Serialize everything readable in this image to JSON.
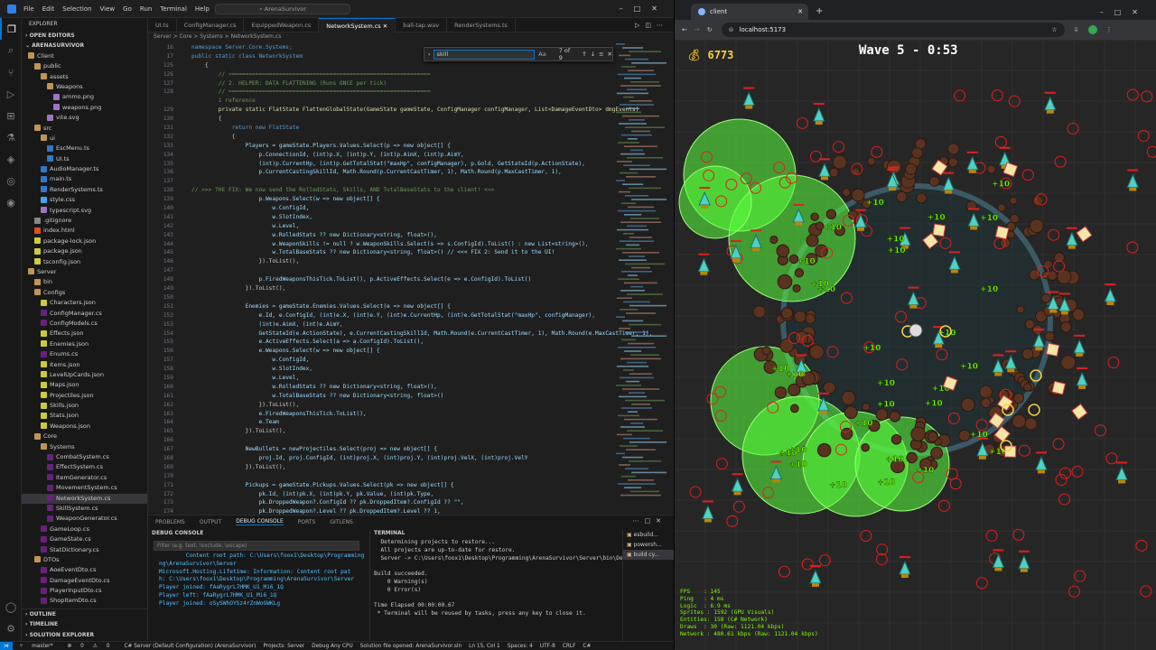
{
  "vscode": {
    "menu": [
      "File",
      "Edit",
      "Selection",
      "View",
      "Go",
      "Run",
      "Terminal",
      "Help"
    ],
    "search_placeholder": "ArenaSurvivor",
    "explorer": {
      "title": "EXPLORER",
      "open_editors": "OPEN EDITORS",
      "root": "ARENASURVIVOR",
      "items": [
        {
          "label": "Client",
          "depth": 1,
          "kind": "folder"
        },
        {
          "label": "public",
          "depth": 2,
          "kind": "folder"
        },
        {
          "label": "assets",
          "depth": 3,
          "kind": "folder"
        },
        {
          "label": "Weapons",
          "depth": 4,
          "kind": "folder"
        },
        {
          "label": "ammo.png",
          "depth": 5,
          "kind": "img"
        },
        {
          "label": "weapons.png",
          "depth": 5,
          "kind": "img"
        },
        {
          "label": "vite.svg",
          "depth": 4,
          "kind": "img"
        },
        {
          "label": "src",
          "depth": 2,
          "kind": "folder"
        },
        {
          "label": "ui",
          "depth": 3,
          "kind": "folder"
        },
        {
          "label": "EscMenu.ts",
          "depth": 4,
          "kind": "ts"
        },
        {
          "label": "UI.ts",
          "depth": 4,
          "kind": "ts"
        },
        {
          "label": "AudioManager.ts",
          "depth": 3,
          "kind": "ts"
        },
        {
          "label": "main.ts",
          "depth": 3,
          "kind": "ts"
        },
        {
          "label": "RenderSystems.ts",
          "depth": 3,
          "kind": "ts"
        },
        {
          "label": "style.css",
          "depth": 3,
          "kind": "css"
        },
        {
          "label": "typescript.svg",
          "depth": 3,
          "kind": "img"
        },
        {
          "label": ".gitignore",
          "depth": 2,
          "kind": "file"
        },
        {
          "label": "index.html",
          "depth": 2,
          "kind": "html"
        },
        {
          "label": "package-lock.json",
          "depth": 2,
          "kind": "json"
        },
        {
          "label": "package.json",
          "depth": 2,
          "kind": "json"
        },
        {
          "label": "tsconfig.json",
          "depth": 2,
          "kind": "json"
        },
        {
          "label": "Server",
          "depth": 1,
          "kind": "folder"
        },
        {
          "label": "bin",
          "depth": 2,
          "kind": "folder"
        },
        {
          "label": "Configs",
          "depth": 2,
          "kind": "folder"
        },
        {
          "label": "Characters.json",
          "depth": 3,
          "kind": "json"
        },
        {
          "label": "ConfigManager.cs",
          "depth": 3,
          "kind": "cs"
        },
        {
          "label": "ConfigModels.cs",
          "depth": 3,
          "kind": "cs"
        },
        {
          "label": "Effects.json",
          "depth": 3,
          "kind": "json"
        },
        {
          "label": "Enemies.json",
          "depth": 3,
          "kind": "json"
        },
        {
          "label": "Enums.cs",
          "depth": 3,
          "kind": "cs"
        },
        {
          "label": "Items.json",
          "depth": 3,
          "kind": "json"
        },
        {
          "label": "LevelUpCards.json",
          "depth": 3,
          "kind": "json"
        },
        {
          "label": "Maps.json",
          "depth": 3,
          "kind": "json"
        },
        {
          "label": "Projectiles.json",
          "depth": 3,
          "kind": "json"
        },
        {
          "label": "Skills.json",
          "depth": 3,
          "kind": "json"
        },
        {
          "label": "Stats.json",
          "depth": 3,
          "kind": "json"
        },
        {
          "label": "Weapons.json",
          "depth": 3,
          "kind": "json"
        },
        {
          "label": "Core",
          "depth": 2,
          "kind": "folder"
        },
        {
          "label": "Systems",
          "depth": 3,
          "kind": "folder"
        },
        {
          "label": "CombatSystem.cs",
          "depth": 4,
          "kind": "cs"
        },
        {
          "label": "EffectSystem.cs",
          "depth": 4,
          "kind": "cs"
        },
        {
          "label": "ItemGenerator.cs",
          "depth": 4,
          "kind": "cs"
        },
        {
          "label": "MovementSystem.cs",
          "depth": 4,
          "kind": "cs"
        },
        {
          "label": "NetworkSystem.cs",
          "depth": 4,
          "kind": "cs",
          "selected": true
        },
        {
          "label": "SkillSystem.cs",
          "depth": 4,
          "kind": "cs"
        },
        {
          "label": "WeaponGenerator.cs",
          "depth": 4,
          "kind": "cs"
        },
        {
          "label": "GameLoop.cs",
          "depth": 3,
          "kind": "cs"
        },
        {
          "label": "GameState.cs",
          "depth": 3,
          "kind": "cs"
        },
        {
          "label": "StatDictionary.cs",
          "depth": 3,
          "kind": "cs"
        },
        {
          "label": "DTOs",
          "depth": 2,
          "kind": "folder"
        },
        {
          "label": "AoeEventDto.cs",
          "depth": 3,
          "kind": "cs"
        },
        {
          "label": "DamageEventDto.cs",
          "depth": 3,
          "kind": "cs"
        },
        {
          "label": "PlayerInputDto.cs",
          "depth": 3,
          "kind": "cs"
        },
        {
          "label": "ShopItemDto.cs",
          "depth": 3,
          "kind": "cs"
        }
      ],
      "outline": "OUTLINE",
      "timeline": "TIMELINE",
      "solution": "SOLUTION EXPLORER"
    },
    "tabs": [
      {
        "label": "UI.ts",
        "active": false
      },
      {
        "label": "ConfigManager.cs",
        "active": false
      },
      {
        "label": "EquippedWeapon.cs",
        "active": false
      },
      {
        "label": "NetworkSystem.cs",
        "active": true
      },
      {
        "label": "ball-tap.wav",
        "active": false
      },
      {
        "label": "RenderSystems.ts",
        "active": false
      }
    ],
    "breadcrumb": "Server > Core > Systems > NetworkSystem.cs",
    "find": {
      "query": "skill",
      "count": "7 of 9"
    },
    "code_lines": [
      {
        "n": "16",
        "t": "namespace Server.Core.Systems;",
        "c": "kw"
      },
      {
        "n": "17",
        "t": "public static class NetworkSystem",
        "c": "kw"
      },
      {
        "n": "125",
        "t": "    {",
        "c": ""
      },
      {
        "n": "126",
        "t": "        // ============================================================",
        "c": "cm"
      },
      {
        "n": "127",
        "t": "        // 2. HELPER: DATA FLATTENING (Runs ONCE per tick)",
        "c": "cm"
      },
      {
        "n": "128",
        "t": "        // ============================================================",
        "c": "cm"
      },
      {
        "n": "",
        "t": "        1 reference",
        "c": "cm"
      },
      {
        "n": "129",
        "t": "        private static FlatState FlattenGlobalState(GameState gameState, ConfigManager configManager, List<DamageEventDto> dmgEvents)",
        "c": "fn"
      },
      {
        "n": "130",
        "t": "        {",
        "c": ""
      },
      {
        "n": "131",
        "t": "            return new FlatState",
        "c": "kw"
      },
      {
        "n": "132",
        "t": "            {",
        "c": ""
      },
      {
        "n": "133",
        "t": "                Players = gameState.Players.Values.Select(p => new object[] {",
        "c": "vr"
      },
      {
        "n": "134",
        "t": "                    p.ConnectionId, (int)p.X, (int)p.Y, (int)p.AimX, (int)p.AimY,",
        "c": "vr"
      },
      {
        "n": "135",
        "t": "                    (int)p.CurrentHp, (int)p.GetTotalStat(\"maxHp\", configManager), p.Gold, GetStateId(p.ActionState),",
        "c": "vr"
      },
      {
        "n": "136",
        "t": "                    p.CurrentCastingSkillId, Math.Round(p.CurrentCastTimer, 1), Math.Round(p.MaxCastTimer, 1),",
        "c": "vr"
      },
      {
        "n": "137",
        "t": "",
        "c": ""
      },
      {
        "n": "138",
        "t": "// >>> THE FIX: We now send the RolledStats, Skills, AND TotalBaseStats to the client! <<<",
        "c": "cm"
      },
      {
        "n": "139",
        "t": "                    p.Weapons.Select(w => new object[] {",
        "c": "vr"
      },
      {
        "n": "140",
        "t": "                        w.ConfigId,",
        "c": "vr"
      },
      {
        "n": "141",
        "t": "                        w.SlotIndex,",
        "c": "vr"
      },
      {
        "n": "142",
        "t": "                        w.Level,",
        "c": "vr"
      },
      {
        "n": "143",
        "t": "                        w.RolledStats ?? new Dictionary<string, float>(),",
        "c": "vr"
      },
      {
        "n": "144",
        "t": "                        w.WeaponSkills != null ? w.WeaponSkills.Select(s => s.ConfigId).ToList() : new List<string>(),",
        "c": "vr"
      },
      {
        "n": "145",
        "t": "                        w.TotalBaseStats ?? new Dictionary<string, float>() // <<< FIX 2: Send it to the UI!",
        "c": "vr"
      },
      {
        "n": "146",
        "t": "                    }).ToList(),",
        "c": ""
      },
      {
        "n": "147",
        "t": "",
        "c": ""
      },
      {
        "n": "148",
        "t": "                    p.FiredWeaponsThisTick.ToList(), p.ActiveEffects.Select(e => e.ConfigId).ToList()",
        "c": "vr"
      },
      {
        "n": "149",
        "t": "                }).ToList(),",
        "c": ""
      },
      {
        "n": "150",
        "t": "",
        "c": ""
      },
      {
        "n": "151",
        "t": "                Enemies = gameState.Enemies.Values.Select(e => new object[] {",
        "c": "vr"
      },
      {
        "n": "152",
        "t": "                    e.Id, e.ConfigId, (int)e.X, (int)e.Y, (int)e.CurrentHp, (int)e.GetTotalStat(\"maxHp\", configManager),",
        "c": "vr"
      },
      {
        "n": "153",
        "t": "                    (int)e.AimX, (int)e.AimY,",
        "c": "vr"
      },
      {
        "n": "154",
        "t": "                    GetStateId(e.ActionState), e.CurrentCastingSkillId, Math.Round(e.CurrentCastTimer, 1), Math.Round(e.MaxCastTimer, 1),",
        "c": "vr"
      },
      {
        "n": "155",
        "t": "                    e.ActiveEffects.Select(a => a.ConfigId).ToList(),",
        "c": "vr"
      },
      {
        "n": "156",
        "t": "                    e.Weapons.Select(w => new object[] {",
        "c": "vr"
      },
      {
        "n": "157",
        "t": "                        w.ConfigId,",
        "c": "vr"
      },
      {
        "n": "158",
        "t": "                        w.SlotIndex,",
        "c": "vr"
      },
      {
        "n": "159",
        "t": "                        w.Level,",
        "c": "vr"
      },
      {
        "n": "160",
        "t": "                        w.RolledStats ?? new Dictionary<string, float>(),",
        "c": "vr"
      },
      {
        "n": "161",
        "t": "                        w.TotalBaseStats ?? new Dictionary<string, float>()",
        "c": "vr"
      },
      {
        "n": "162",
        "t": "                    }).ToList(),",
        "c": ""
      },
      {
        "n": "163",
        "t": "                    e.FiredWeaponsThisTick.ToList(),",
        "c": "vr"
      },
      {
        "n": "164",
        "t": "                    e.Team",
        "c": "vr"
      },
      {
        "n": "165",
        "t": "                }).ToList(),",
        "c": ""
      },
      {
        "n": "166",
        "t": "",
        "c": ""
      },
      {
        "n": "167",
        "t": "                NewBullets = newProjectiles.Select(proj => new object[] {",
        "c": "vr"
      },
      {
        "n": "168",
        "t": "                    proj.Id, proj.ConfigId, (int)proj.X, (int)proj.Y, (int)proj.VelX, (int)proj.VelY",
        "c": "vr"
      },
      {
        "n": "169",
        "t": "                }).ToList(),",
        "c": ""
      },
      {
        "n": "170",
        "t": "",
        "c": ""
      },
      {
        "n": "171",
        "t": "                Pickups = gameState.Pickups.Values.Select(pk => new object[] {",
        "c": "vr"
      },
      {
        "n": "172",
        "t": "                    pk.Id, (int)pk.X, (int)pk.Y, pk.Value, (int)pk.Type,",
        "c": "vr"
      },
      {
        "n": "173",
        "t": "                    pk.DroppedWeapon?.ConfigId ?? pk.DroppedItem?.ConfigId ?? \"\",",
        "c": "vr"
      },
      {
        "n": "174",
        "t": "                    pk.DroppedWeapon?.Level ?? pk.DroppedItem?.Level ?? 1,",
        "c": "vr"
      }
    ],
    "panel_tabs": [
      "PROBLEMS",
      "OUTPUT",
      "DEBUG CONSOLE",
      "PORTS",
      "GITLENS"
    ],
    "debug_title": "DEBUG CONSOLE",
    "debug_filter": "Filter (e.g. text, !exclude, \\escape)",
    "debug_lines": [
      "        Content root path: C:\\Users\\foox1\\Desktop\\Programming",
      "ng\\ArenaSurvivor\\Server",
      "Microsoft.Hosting.Lifetime: Information: Content root pat",
      "h: C:\\Users\\foox1\\Desktop\\Programming\\ArenaSurvivor\\Server",
      "Player joined: fAaRygrL7HMK_U1_Mi6_1Q",
      "Player left: fAaRygrL7HMK_U1_Mi6_1Q",
      "Player joined: oSySWhOYSz4rZnWoGWKLg"
    ],
    "terminal_title": "TERMINAL",
    "terminal_lines": [
      "  Determining projects to restore...",
      "  All projects are up-to-date for restore.",
      "  Server -> C:\\Users\\foox1\\Desktop\\Programming\\ArenaSurvivor\\Server\\bin\\Debug\\net10.0\\Server.dll",
      "",
      "Build succeeded.",
      "    0 Warning(s)",
      "    0 Error(s)",
      "",
      "Time Elapsed 00:00:00.67",
      " * Terminal will be reused by tasks, press any key to close it."
    ],
    "terminal_list": [
      "esbuild...",
      "powersh...",
      "build cy..."
    ],
    "status": {
      "branch": "master*",
      "errors": "0",
      "warnings": "0",
      "server": "C# Server (Default Configuration) (ArenaSurvivor)",
      "projects": "Projects: Server",
      "debug": "Debug Any CPU",
      "solution": "Solution file opened: ArenaSurvivor.sln",
      "position": "Ln 15, Col 1",
      "spaces": "Spaces: 4",
      "encoding": "UTF-8",
      "eol": "CRLF",
      "lang": "C#"
    }
  },
  "browser": {
    "tab_title": "client",
    "url": "localhost:5173"
  },
  "game": {
    "gold": "6773",
    "wave": "Wave 5 - 0:53",
    "stats": [
      "FPS    : 145",
      "Ping   : 4 ms",
      "Logic  : 6.9 ms",
      "Sprites : 1592 (GPU Visuals)",
      "Entities: 158 (C# Network)",
      "Draws  : 30 (Raw: 1121.04 kbps)",
      "Network : 480.61 kbps (Raw: 1121.04 kbps)"
    ],
    "damage_number": "+10",
    "colors": {
      "aoe": "#5aff3c",
      "ring": "#3b5a66",
      "enemy_red": "#e0201e",
      "gold": "#f7d23e",
      "stats": "#7cfc00"
    }
  }
}
